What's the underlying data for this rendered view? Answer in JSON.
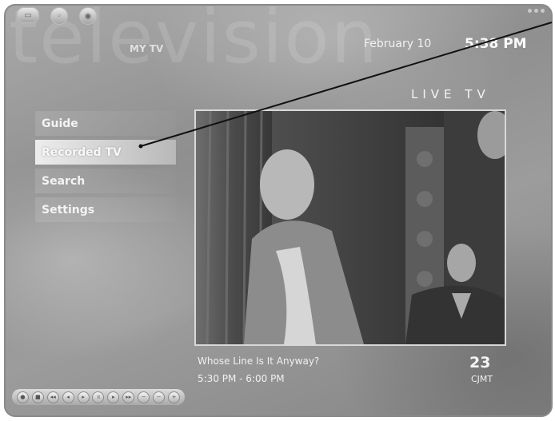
{
  "watermark": "television",
  "branding": {
    "mytv": "MY TV"
  },
  "header": {
    "date": "February 10",
    "time": "5:38 PM"
  },
  "section_title": "LIVE TV",
  "menu": {
    "items": [
      {
        "label": "Guide",
        "selected": false
      },
      {
        "label": "Recorded TV",
        "selected": true
      },
      {
        "label": "Search",
        "selected": false
      },
      {
        "label": "Settings",
        "selected": false
      }
    ]
  },
  "program": {
    "title": "Whose Line Is It Anyway?",
    "time": "5:30 PM - 6:00 PM",
    "channel_number": "23",
    "channel_name": "CJMT"
  },
  "top_buttons": [
    {
      "icon": "tv-icon",
      "symbol": "▭"
    },
    {
      "icon": "back-icon",
      "symbol": "◦"
    },
    {
      "icon": "home-icon",
      "symbol": "◉"
    }
  ],
  "transport_controls": [
    {
      "icon": "record-icon",
      "symbol": "●"
    },
    {
      "icon": "stop-icon",
      "symbol": "■"
    },
    {
      "icon": "rewind-icon",
      "symbol": "◂◂"
    },
    {
      "icon": "skip-back-icon",
      "symbol": "◂"
    },
    {
      "icon": "play-icon",
      "symbol": "▸"
    },
    {
      "icon": "pause-icon",
      "symbol": "॥"
    },
    {
      "icon": "skip-forward-icon",
      "symbol": "▸"
    },
    {
      "icon": "fast-forward-icon",
      "symbol": "▸▸"
    },
    {
      "icon": "channel-down-icon",
      "symbol": "−"
    },
    {
      "icon": "volume-down-icon",
      "symbol": "−"
    },
    {
      "icon": "volume-up-icon",
      "symbol": "+"
    }
  ],
  "colors": {
    "accent": "#ededed",
    "background": "#9a9a9a"
  }
}
